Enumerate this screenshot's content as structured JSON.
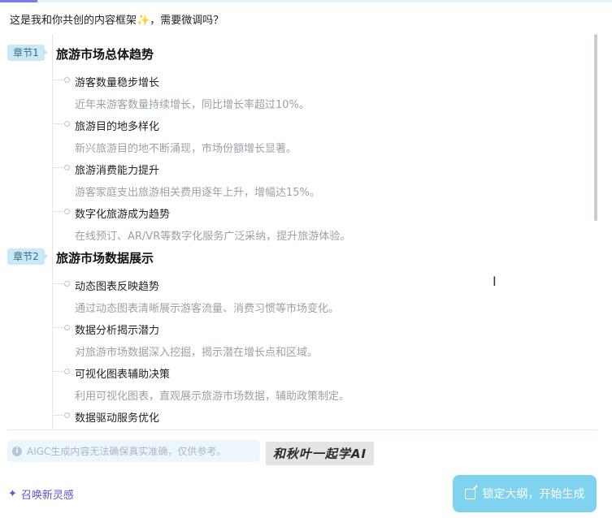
{
  "intro": {
    "text": "这是我和你共创的内容框架",
    "emoji": "✨",
    "suffix": "，需要微调吗？"
  },
  "chapters": [
    {
      "badge": "章节1",
      "title": "旅游市场总体趋势",
      "items": [
        {
          "title": "游客数量稳步增长",
          "desc": "近年来游客数量持续增长，同比增长率超过10%。"
        },
        {
          "title": "旅游目的地多样化",
          "desc": "新兴旅游目的地不断涌现，市场份额增长显著。"
        },
        {
          "title": "旅游消费能力提升",
          "desc": "游客家庭支出旅游相关费用逐年上升，增幅达15%。"
        },
        {
          "title": "数字化旅游成为趋势",
          "desc": "在线预订、AR/VR等数字化服务广泛采纳，提升旅游体验。"
        }
      ]
    },
    {
      "badge": "章节2",
      "title": "旅游市场数据展示",
      "items": [
        {
          "title": "动态图表反映趋势",
          "desc": "通过动态图表清晰展示游客流量、消费习惯等市场变化。"
        },
        {
          "title": "数据分析揭示潜力",
          "desc": "对旅游市场数据深入挖掘，揭示潜在增长点和区域。"
        },
        {
          "title": "可视化图表辅助决策",
          "desc": "利用可视化图表，直观展示旅游市场数据，辅助政策制定。"
        },
        {
          "title": "数据驱动服务优化",
          "desc": ""
        }
      ]
    }
  ],
  "disclaimer": "AIGC生成内容无法确保真实准确，仅供参考。",
  "watermark": "和秋叶一起学AI",
  "actions": {
    "summon_label": "召唤新灵感",
    "generate_label": "锁定大纲，开始生成"
  },
  "colors": {
    "accent": "#5b55d6",
    "button": "#7fd3ee",
    "badge_bg": "#c8e9f5"
  }
}
